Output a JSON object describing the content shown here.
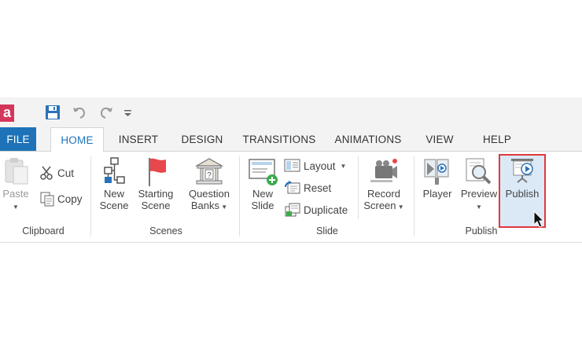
{
  "qat": {
    "app_logo": "a",
    "icons": [
      "save-icon",
      "undo-icon",
      "redo-icon",
      "customize-qat-icon"
    ]
  },
  "tabs": [
    {
      "label": "FILE"
    },
    {
      "label": "HOME"
    },
    {
      "label": "INSERT"
    },
    {
      "label": "DESIGN"
    },
    {
      "label": "TRANSITIONS"
    },
    {
      "label": "ANIMATIONS"
    },
    {
      "label": "VIEW"
    },
    {
      "label": "HELP"
    }
  ],
  "active_tab": "HOME",
  "groups": {
    "clipboard": {
      "label": "Clipboard",
      "paste": "Paste",
      "cut": "Cut",
      "copy": "Copy"
    },
    "scenes": {
      "label": "Scenes",
      "new_scene_1": "New",
      "new_scene_2": "Scene",
      "starting_scene_1": "Starting",
      "starting_scene_2": "Scene",
      "question_banks_1": "Question",
      "question_banks_2": "Banks"
    },
    "slide": {
      "label": "Slide",
      "new_slide_1": "New",
      "new_slide_2": "Slide",
      "layout": "Layout",
      "reset": "Reset",
      "duplicate": "Duplicate",
      "record_screen_1": "Record",
      "record_screen_2": "Screen"
    },
    "publish": {
      "label": "Publish",
      "player": "Player",
      "preview": "Preview",
      "publish": "Publish"
    }
  },
  "colors": {
    "file_tab": "#1e73b8",
    "active_tab_text": "#1e73b8",
    "highlight_border": "#e0393c",
    "highlight_fill": "#dbe9f6",
    "flag": "#e8474b"
  }
}
